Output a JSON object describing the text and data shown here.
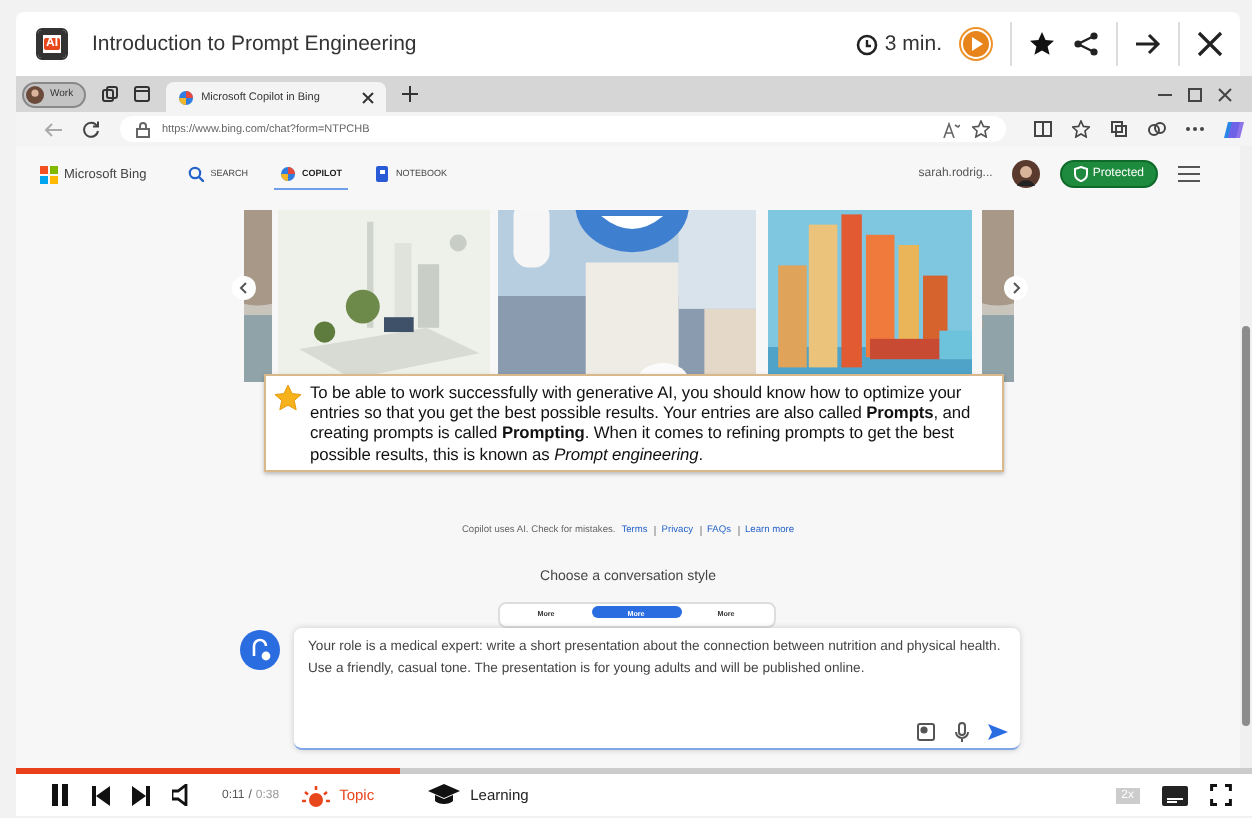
{
  "lesson": {
    "icon_label": "AI",
    "title": "Introduction to Prompt Engineering",
    "duration": "3 min."
  },
  "browser": {
    "profile": "Work",
    "tab_title": "Microsoft Copilot in Bing",
    "url": "https://www.bing.com/chat?form=NTPCHB"
  },
  "bing": {
    "brand": "Microsoft Bing",
    "nav": [
      {
        "label": "SEARCH",
        "selected": false
      },
      {
        "label": "COPILOT",
        "selected": true
      },
      {
        "label": "NOTEBOOK",
        "selected": false
      }
    ],
    "user": "sarah.rodrig...",
    "protected": "Protected"
  },
  "callout": "To be able to work successfully with generative AI, you should know how to optimize your entries so that you get the best possible results. Your entries are also called **Prompts**, and creating prompts is called **Prompting**. When it comes to refining prompts to get the best possible results, this is known as *Prompt engineering*.",
  "disclaimer": {
    "text": "Copilot uses AI. Check for mistakes.",
    "links": [
      "Terms",
      "Privacy",
      "FAQs",
      "Learn more"
    ]
  },
  "style_heading": "Choose a conversation style",
  "styles": [
    {
      "label": "More",
      "selected": false
    },
    {
      "label": "More",
      "selected": true
    },
    {
      "label": "More",
      "selected": false
    }
  ],
  "prompt": "Your role is a medical expert: write a short presentation about the connection between nutrition and physical health. Use a friendly, casual tone. The presentation is for young adults and will be published online.",
  "player": {
    "level": 0.31,
    "time": "0:11",
    "separator": "/",
    "duration": "0:38",
    "topic": "Topic",
    "learning": "Learning",
    "speed": "2x"
  }
}
